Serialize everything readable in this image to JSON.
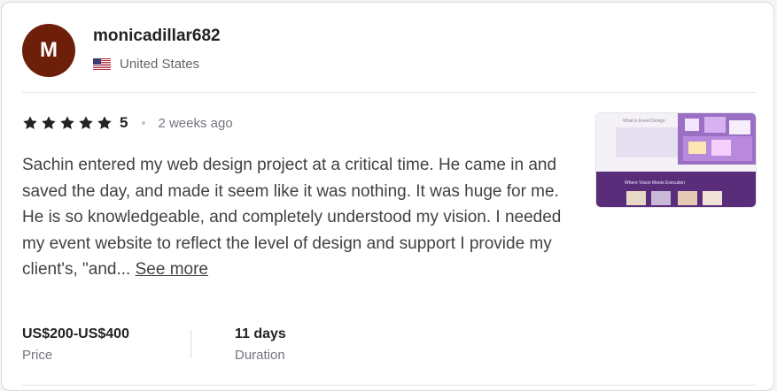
{
  "reviewer": {
    "avatar_initial": "M",
    "avatar_color": "#6e1f0a",
    "username": "monicadillar682",
    "country": "United States",
    "flag_icon": "us-flag-icon"
  },
  "rating": {
    "stars": 5,
    "score": "5",
    "time_ago": "2 weeks ago",
    "star_icon": "star-icon"
  },
  "review": {
    "text": "Sachin entered my web design project at a critical time. He came in and saved the day, and made it seem like it was nothing. It was huge for me. He is so knowledgeable, and completely understood my vision. I needed my event website to reflect the level of design and support I provide my client's, \"and... ",
    "see_more_label": "See more"
  },
  "thumbnail": {
    "preview_title": "What is Event Design",
    "preview_banner": "Where Vision Meets Execution"
  },
  "stats": {
    "price_value": "US$200-US$400",
    "price_label": "Price",
    "duration_value": "11 days",
    "duration_label": "Duration"
  },
  "colors": {
    "text_dark": "#222325",
    "text_body": "#404145",
    "text_muted": "#74767e",
    "thumbnail_purple": "#5a2d7a"
  }
}
